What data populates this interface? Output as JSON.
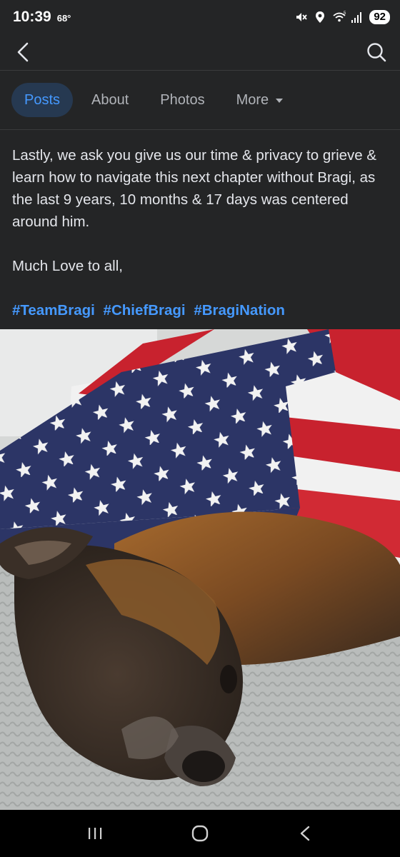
{
  "status_bar": {
    "time": "10:39",
    "temperature": "68°",
    "battery": "92",
    "icons": [
      "mute-icon",
      "location-icon",
      "wifi-icon",
      "signal-icon"
    ]
  },
  "header": {
    "back_icon": "chevron-left-icon",
    "search_icon": "search-icon"
  },
  "tabs": [
    {
      "label": "Posts",
      "active": true
    },
    {
      "label": "About",
      "active": false
    },
    {
      "label": "Photos",
      "active": false
    },
    {
      "label": "More",
      "active": false
    }
  ],
  "post": {
    "paragraph1": "Lastly, we ask you give us our time & privacy to grieve & learn how to navigate this next chapter without Bragi, as the last 9 years, 10 months & 17 days was centered around him.",
    "paragraph2": "Much Love to all,",
    "hashtags": [
      "#TeamBragi",
      "#ChiefBragi",
      "#BragiNation"
    ]
  },
  "nav_bar": {
    "buttons": [
      "recent-apps-icon",
      "home-icon",
      "back-icon"
    ]
  },
  "colors": {
    "background": "#242526",
    "text": "#e4e6eb",
    "accent": "#4599ff",
    "active_tab_bg": "#263951"
  }
}
